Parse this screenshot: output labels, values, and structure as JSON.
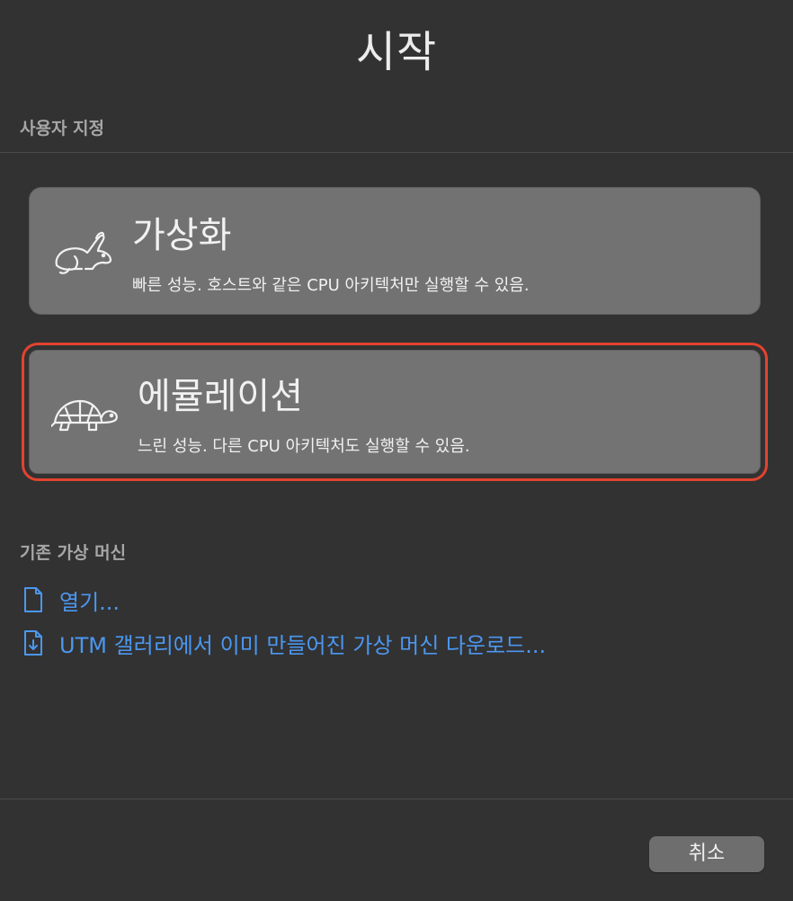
{
  "window": {
    "title": "시작"
  },
  "custom_section": {
    "label": "사용자 지정",
    "options": [
      {
        "title": "가상화",
        "description": "빠른 성능. 호스트와 같은 CPU 아키텍처만 실행할 수 있음.",
        "icon": "rabbit-icon",
        "selected": false
      },
      {
        "title": "에뮬레이션",
        "description": "느린 성능. 다른 CPU 아키텍처도 실행할 수 있음.",
        "icon": "turtle-icon",
        "selected": true
      }
    ]
  },
  "existing_section": {
    "label": "기존 가상 머신",
    "links": [
      {
        "label": "열기...",
        "icon": "document-icon"
      },
      {
        "label": "UTM 갤러리에서 이미 만들어진 가상 머신 다운로드...",
        "icon": "document-download-icon"
      }
    ]
  },
  "footer": {
    "cancel_label": "취소"
  },
  "colors": {
    "background": "#323232",
    "card": "#727272",
    "selection_outline": "#e2432f",
    "link": "#4c97f0"
  }
}
